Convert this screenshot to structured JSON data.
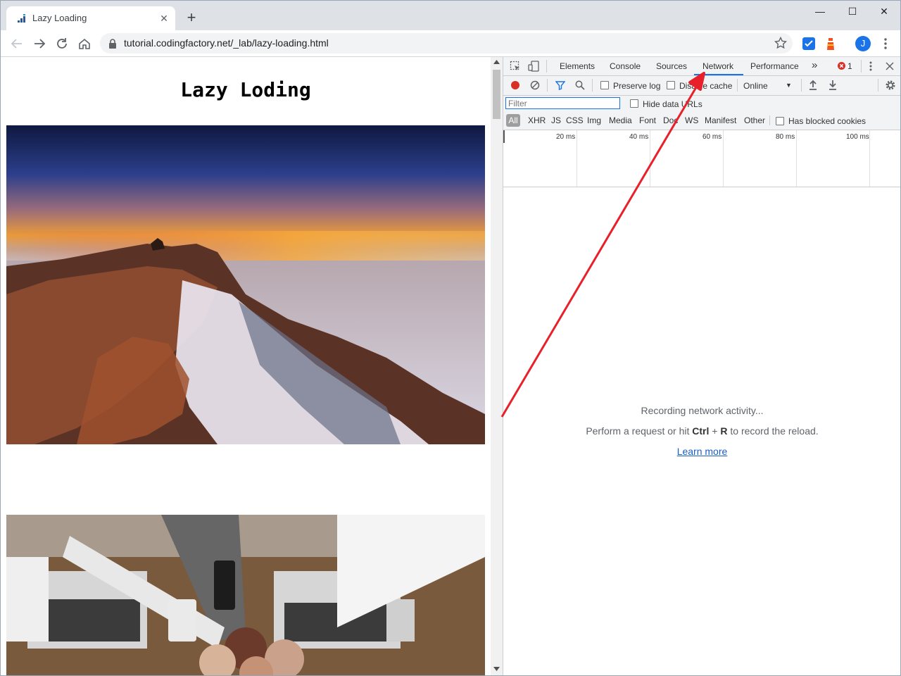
{
  "browser": {
    "tab_title": "Lazy Loading",
    "tab_close_glyph": "✕",
    "new_tab_glyph": "+",
    "window_controls": {
      "minimize": "—",
      "maximize": "☐",
      "close": "✕"
    },
    "url": "tutorial.codingfactory.net/_lab/lazy-loading.html",
    "profile_initial": "J"
  },
  "page": {
    "heading": "Lazy Loding",
    "images": [
      {
        "name": "seascape-sunset-rocks-image"
      },
      {
        "name": "team-fist-bump-laptops-image"
      }
    ]
  },
  "devtools": {
    "tabs": [
      "Elements",
      "Console",
      "Sources",
      "Network",
      "Performance"
    ],
    "active_tab": "Network",
    "more_tabs_glyph": "»",
    "error_count": "1",
    "toolbar": {
      "preserve_log": "Preserve log",
      "disable_cache": "Disable cache",
      "throttling": "Online",
      "dropdown_glyph": "▼"
    },
    "filter": {
      "placeholder": "Filter",
      "hide_data_urls": "Hide data URLs",
      "types": [
        "All",
        "XHR",
        "JS",
        "CSS",
        "Img",
        "Media",
        "Font",
        "Doc",
        "WS",
        "Manifest",
        "Other"
      ],
      "has_blocked_cookies": "Has blocked cookies"
    },
    "timeline_ticks": [
      "20 ms",
      "40 ms",
      "60 ms",
      "80 ms",
      "100 ms"
    ],
    "empty_state": {
      "line1": "Recording network activity...",
      "line2_prefix": "Perform a request or hit ",
      "key1": "Ctrl",
      "plus": " + ",
      "key2": "R",
      "line2_suffix": " to record the reload.",
      "link": "Learn more"
    }
  },
  "colors": {
    "accent": "#1a73e8",
    "record_red": "#d93025",
    "annotation_arrow": "#e8202a",
    "tabstrip_bg": "#dee1e6",
    "devtools_bar_bg": "#f1f3f4"
  }
}
